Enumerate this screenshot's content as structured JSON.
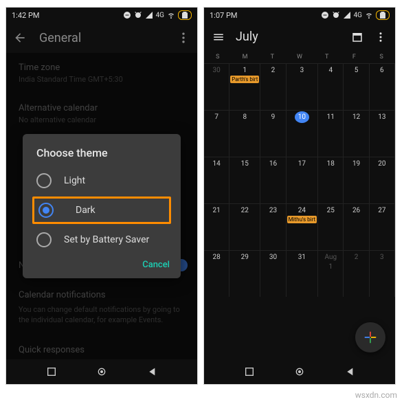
{
  "left": {
    "status_time": "1:42 PM",
    "net": "4G",
    "title": "General",
    "settings": {
      "timezone_label": "Time zone",
      "timezone_value": "India Standard Time  GMT+5:30",
      "altcal_label": "Alternative calendar",
      "altcal_value": "No alternative calendar",
      "notify_label": "Notify on this device",
      "calnotif_label": "Calendar notifications",
      "note": "You can change default notifications by going to the individual calendar, for example Events.",
      "quick_label": "Quick responses"
    },
    "dialog": {
      "title": "Choose theme",
      "opt_light": "Light",
      "opt_dark": "Dark",
      "opt_battery": "Set by Battery Saver",
      "cancel": "Cancel"
    }
  },
  "right": {
    "status_time": "1:07 PM",
    "net": "4G",
    "month": "July",
    "dow": [
      "S",
      "M",
      "T",
      "W",
      "T",
      "F",
      "S"
    ],
    "events": {
      "d1": "Parth's birt",
      "d24": "Mithu's birt"
    },
    "today": 10,
    "days_prev": [
      30
    ],
    "days": [
      1,
      2,
      3,
      4,
      5,
      6,
      7,
      8,
      9,
      10,
      11,
      12,
      13,
      14,
      15,
      16,
      17,
      18,
      19,
      20,
      21,
      22,
      23,
      24,
      25,
      26,
      27,
      28,
      29,
      30,
      31
    ],
    "days_next": [
      1,
      2,
      3
    ],
    "next_month_label": "Aug"
  },
  "watermark": "wsxdn.com"
}
